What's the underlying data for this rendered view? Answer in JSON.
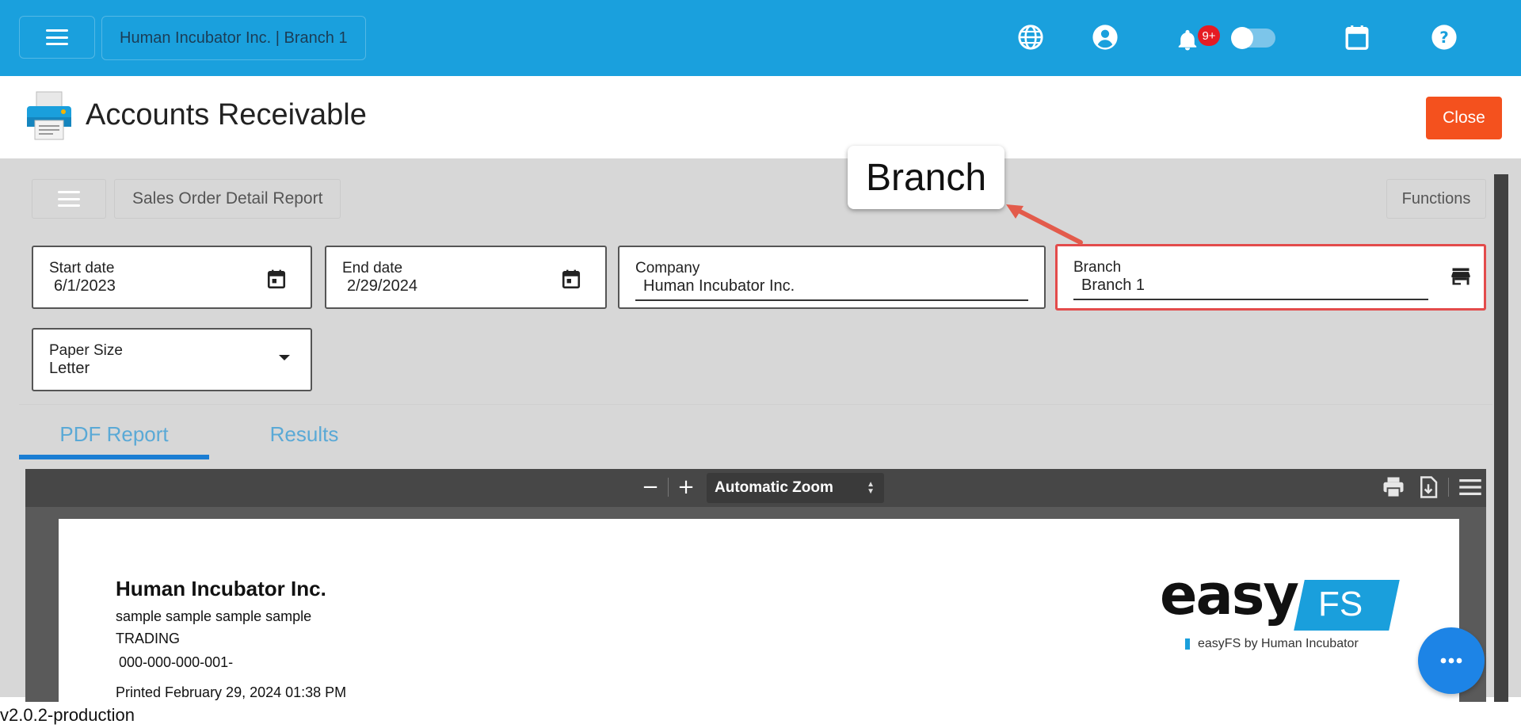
{
  "topbar": {
    "company_chip": "Human Incubator Inc. | Branch 1",
    "notification_badge": "9+",
    "icons": [
      "menu-icon",
      "globe-icon",
      "account-circle-icon",
      "bell-icon",
      "theme-toggle",
      "moon-icon",
      "calendar-icon",
      "help-icon"
    ]
  },
  "header": {
    "title": "Accounts Receivable",
    "close_label": "Close"
  },
  "report_bar": {
    "report_name": "Sales Order Detail Report",
    "functions_label": "Functions"
  },
  "filters": {
    "start_date": {
      "label": "Start date",
      "value": "6/1/2023"
    },
    "end_date": {
      "label": "End date",
      "value": "2/29/2024"
    },
    "company": {
      "label": "Company",
      "value": "Human Incubator Inc."
    },
    "branch": {
      "label": "Branch",
      "value": "Branch 1"
    },
    "paper_size": {
      "label": "Paper Size",
      "value": "Letter"
    }
  },
  "tabs": [
    {
      "label": "PDF Report",
      "active": true
    },
    {
      "label": "Results",
      "active": false
    }
  ],
  "pdf_viewer": {
    "zoom_out": "−",
    "zoom_in": "+",
    "zoom_label": "Automatic Zoom"
  },
  "document": {
    "company": "Human Incubator Inc.",
    "line1": "sample sample sample sample",
    "line2": "TRADING",
    "line3": "000-000-000-001-",
    "printed": "Printed February 29, 2024 01:38 PM",
    "logo_text": "easy",
    "logo_fs": "FS",
    "logo_sub": "easyFS by Human Incubator"
  },
  "callout": {
    "label": "Branch"
  },
  "footer": {
    "version": "v2.0.2-production"
  },
  "colors": {
    "topbar": "#1aa0dd",
    "close": "#f4511e",
    "tab_active": "#1a7dd3",
    "highlight": "#e34b4b",
    "fab": "#1d84e6"
  }
}
